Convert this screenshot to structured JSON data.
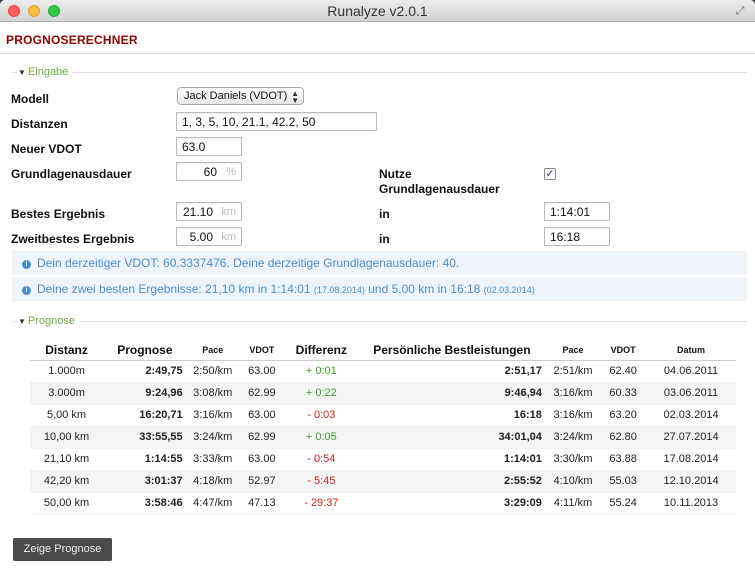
{
  "window": {
    "title": "Runalyze v2.0.1"
  },
  "panel": {
    "title": "PROGNOSERECHNER"
  },
  "eingabe": {
    "legend": "Eingabe",
    "modell_label": "Modell",
    "modell_value": "Jack Daniels (VDOT)",
    "distanzen_label": "Distanzen",
    "distanzen_value": "1, 3, 5, 10, 21.1, 42.2, 50",
    "vdot_label": "Neuer VDOT",
    "vdot_value": "63.0",
    "grundlagen_label": "Grundlagenausdauer",
    "grundlagen_value": "60",
    "grundlagen_unit": "%",
    "nutze_label": "Nutze Grundlagenausdauer",
    "nutze_checked": "✓",
    "bestes_label": "Bestes Ergebnis",
    "bestes_value": "21.10",
    "bestes_unit": "km",
    "bestes_in_label": "in",
    "bestes_time": "1:14:01",
    "zweit_label": "Zweitbestes Ergebnis",
    "zweit_value": "5.00",
    "zweit_unit": "km",
    "zweit_in_label": "in",
    "zweit_time": "16:18"
  },
  "info": {
    "line1": "Dein derzeitiger VDOT: 60.3337476. Deine derzeitige Grundlagenausdauer: 40.",
    "line2_a": "Deine zwei besten Ergebnisse: 21,10 km in 1:14:01",
    "line2_date1": "(17.08.2014)",
    "line2_b": "und 5,00 km in 16:18",
    "line2_date2": "(02.03.2014)"
  },
  "prognose": {
    "legend": "Prognose",
    "headers": {
      "distanz": "Distanz",
      "prognose": "Prognose",
      "pace": "Pace",
      "vdot": "VDOT",
      "differenz": "Differenz",
      "bestleistungen": "Persönliche Bestleistungen",
      "pace2": "Pace",
      "vdot2": "VDOT",
      "datum": "Datum"
    },
    "rows": [
      {
        "distanz": "1.000m",
        "prognose": "2:49,75",
        "pace": "2:50/km",
        "vdot": "63.00",
        "diff": "+ 0:01",
        "diff_sign": "pos",
        "best": "2:51,17",
        "pace2": "2:51/km",
        "vdot2": "62.40",
        "datum": "04.06.2011"
      },
      {
        "distanz": "3.000m",
        "prognose": "9:24,96",
        "pace": "3:08/km",
        "vdot": "62.99",
        "diff": "+ 0:22",
        "diff_sign": "pos",
        "best": "9:46,94",
        "pace2": "3:16/km",
        "vdot2": "60.33",
        "datum": "03.06.2011"
      },
      {
        "distanz": "5,00 km",
        "prognose": "16:20,71",
        "pace": "3:16/km",
        "vdot": "63.00",
        "diff": "- 0:03",
        "diff_sign": "neg",
        "best": "16:18",
        "pace2": "3:16/km",
        "vdot2": "63.20",
        "datum": "02.03.2014"
      },
      {
        "distanz": "10,00 km",
        "prognose": "33:55,55",
        "pace": "3:24/km",
        "vdot": "62.99",
        "diff": "+ 0:05",
        "diff_sign": "pos",
        "best": "34:01,04",
        "pace2": "3:24/km",
        "vdot2": "62.80",
        "datum": "27.07.2014"
      },
      {
        "distanz": "21,10 km",
        "prognose": "1:14:55",
        "pace": "3:33/km",
        "vdot": "63.00",
        "diff": "- 0:54",
        "diff_sign": "neg",
        "best": "1:14:01",
        "pace2": "3:30/km",
        "vdot2": "63.88",
        "datum": "17.08.2014"
      },
      {
        "distanz": "42,20 km",
        "prognose": "3:01:37",
        "pace": "4:18/km",
        "vdot": "52.97",
        "diff": "- 5:45",
        "diff_sign": "neg",
        "best": "2:55:52",
        "pace2": "4:10/km",
        "vdot2": "55.03",
        "datum": "12.10.2014"
      },
      {
        "distanz": "50,00 km",
        "prognose": "3:58:46",
        "pace": "4:47/km",
        "vdot": "47.13",
        "diff": "- 29:37",
        "diff_sign": "neg",
        "best": "3:29:09",
        "pace2": "4:11/km",
        "vdot2": "55.24",
        "datum": "10.11.2013"
      }
    ]
  },
  "button": {
    "label": "Zeige Prognose"
  },
  "colors": {
    "title_red": "#8b0000",
    "legend_green": "#6cae3f",
    "info_blue": "#4a8ec9",
    "diff_pos": "#3a9c2c",
    "diff_neg": "#cc2222"
  }
}
